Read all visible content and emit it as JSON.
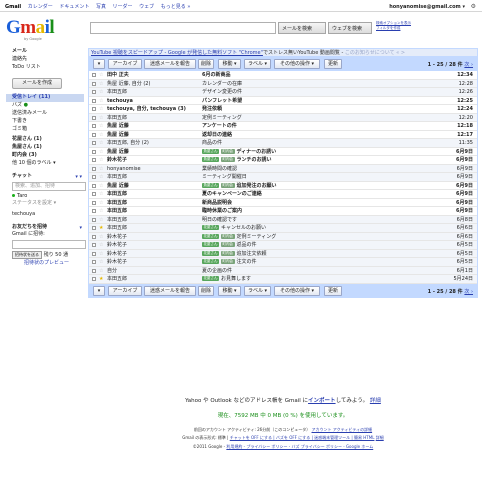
{
  "topnav": [
    "Gmail",
    "カレンダー",
    "ドキュメント",
    "写真",
    "リーダー",
    "ウェブ",
    "もっと見る »"
  ],
  "account_email": "honyanomise@gmail.com ▾",
  "logo": {
    "text": "Gmail",
    "sub": "by Google"
  },
  "search": {
    "mail_button": "メールを検索",
    "web_button": "ウェブを検索",
    "options_link_1": "検索オプションを表示",
    "options_link_2": "フィルタを作成"
  },
  "sidebar": {
    "top_items": [
      "メール",
      "連絡先",
      "ToDo リスト"
    ],
    "compose": "メールを作成",
    "items": [
      "受信トレイ (11)",
      "バズ",
      "送信済みメール",
      "下書き",
      "ゴミ箱"
    ],
    "labels": [
      "花屋さん (1)",
      "魚屋さん (1)",
      "町内会 (3)",
      "他 10 個のラベル ▾"
    ],
    "chat_title": "チャット",
    "chat_search": "検索、追加、招待",
    "chat_user": "Taro",
    "chat_status": "ステータスを設定 ▾",
    "chat_contact": "techouya",
    "invite_title": "お友だちを招待",
    "invite_text": "Gmail に招待:",
    "invite_button": "招待状を送る",
    "invite_remaining": "残り 50 通",
    "invite_preview": "招待状のプレビュー"
  },
  "promo": {
    "link": "YouTube 視聴をスピードアップ - Google が発信した無料ソフト \"Chrome\"",
    "text": "でストレス無いYouTube 動画閲覧 - ",
    "tail": "このお知らせについて « >"
  },
  "toolbar": {
    "archive": "アーカイブ",
    "spam": "迷惑メールを報告",
    "delete": "削除",
    "move": "移動 ▾",
    "label": "ラベル ▾",
    "more": "その他の操作 ▾",
    "refresh": "更新",
    "count": "1 - 25 / 28 件",
    "next": "次 ›"
  },
  "emails": [
    {
      "sender": "田中 正夫",
      "subject": "6月の新商品",
      "labels": [],
      "time": "12:34",
      "unread": true,
      "star": false
    },
    {
      "sender": "魚屋 近藤, 自分 (2)",
      "subject": "カレンダーの在庫",
      "labels": [],
      "time": "12:28",
      "unread": false,
      "star": false
    },
    {
      "sender": "本田五郎",
      "subject": "デザイン変更の件",
      "labels": [],
      "time": "12:26",
      "unread": false,
      "star": false
    },
    {
      "sender": "techouya",
      "subject": "パンフレット希望",
      "labels": [],
      "time": "12:25",
      "unread": true,
      "star": false
    },
    {
      "sender": "techouya, 自分, techouya (3)",
      "subject": "発注依頼",
      "labels": [],
      "time": "12:24",
      "unread": true,
      "star": false
    },
    {
      "sender": "本田五郎",
      "subject": "定例ミーティング",
      "labels": [],
      "time": "12:20",
      "unread": false,
      "star": false
    },
    {
      "sender": "魚屋 近藤",
      "subject": "アンケートの件",
      "labels": [],
      "time": "12:18",
      "unread": true,
      "star": false
    },
    {
      "sender": "魚屋 近藤",
      "subject": "返却日の連絡",
      "labels": [],
      "time": "12:17",
      "unread": true,
      "star": false
    },
    {
      "sender": "本田五郎, 自分 (2)",
      "subject": "商品の件",
      "labels": [],
      "time": "11:35",
      "unread": false,
      "star": false
    },
    {
      "sender": "魚屋 近藤",
      "subject": "ディナーのお誘い",
      "labels": [
        "魚屋さん",
        "町内会"
      ],
      "time": "6月9日",
      "unread": true,
      "star": false
    },
    {
      "sender": "鈴木花子",
      "subject": "ランチのお誘い",
      "labels": [
        "魚屋さん",
        "町内会"
      ],
      "time": "6月9日",
      "unread": true,
      "star": false
    },
    {
      "sender": "honyanomise",
      "subject": "業績時間の確認",
      "labels": [],
      "time": "6月9日",
      "unread": false,
      "star": false
    },
    {
      "sender": "本田五郎",
      "subject": "ミーティング開催日",
      "labels": [],
      "time": "6月9日",
      "unread": false,
      "star": false
    },
    {
      "sender": "魚屋 近藤",
      "subject": "追加発注のお願い",
      "labels": [
        "魚屋さん",
        "町内会"
      ],
      "time": "6月9日",
      "unread": true,
      "star": false
    },
    {
      "sender": "本田五郎",
      "subject": "夏のキャンペーンのご連絡",
      "labels": [],
      "time": "6月9日",
      "unread": true,
      "star": false
    },
    {
      "sender": "本田五郎",
      "subject": "新商品説明会",
      "labels": [],
      "time": "6月9日",
      "unread": true,
      "star": false
    },
    {
      "sender": "本田五郎",
      "subject": "臨時休業のご案内",
      "labels": [],
      "time": "6月9日",
      "unread": true,
      "star": false
    },
    {
      "sender": "本田五郎",
      "subject": "明日の確認です",
      "labels": [],
      "time": "6月8日",
      "unread": false,
      "star": false
    },
    {
      "sender": "本田五郎",
      "subject": "キャンセルのお願い",
      "labels": [
        "花屋さん"
      ],
      "time": "6月6日",
      "unread": false,
      "star": true
    },
    {
      "sender": "鈴木花子",
      "subject": "定例ミーティング",
      "labels": [
        "花屋さん",
        "町内会"
      ],
      "time": "6月6日",
      "unread": false,
      "star": false
    },
    {
      "sender": "鈴木花子",
      "subject": "返品の件",
      "labels": [
        "花屋さん",
        "町内会"
      ],
      "time": "6月5日",
      "unread": false,
      "star": false
    },
    {
      "sender": "鈴木花子",
      "subject": "追加注文依頼",
      "labels": [
        "花屋さん",
        "町内会"
      ],
      "time": "6月5日",
      "unread": false,
      "star": false
    },
    {
      "sender": "鈴木花子",
      "subject": "注文の件",
      "labels": [
        "花屋さん",
        "町内会"
      ],
      "time": "6月5日",
      "unread": false,
      "star": false
    },
    {
      "sender": "自分",
      "subject": "夏の企画の件",
      "labels": [],
      "time": "6月1日",
      "unread": false,
      "star": false
    },
    {
      "sender": "本田五郎",
      "subject": "お見舞します",
      "labels": [
        "花屋さん"
      ],
      "time": "5月24日",
      "unread": false,
      "star": true
    }
  ],
  "footer": {
    "import_prefix": "Yahoo や Outlook などのアドレス帳を Gmail に",
    "import_link": "インポート",
    "import_suffix": "してみよう。",
    "import_detail": "詳細",
    "usage": "現在、7592 MB 中 0 MB (0 %) を使用しています。",
    "activity": "前回のアカウント アクティビティ: 26分前（このコンピュータ）",
    "activity_link": "アカウント アクティビティの詳細",
    "view": "Gmail の表示形式: 標準 |",
    "view_links": "チャットを OFF にする | バズを OFF にする | 迷惑端末管理ツール | 簡易 HTML",
    "view_detail": "詳細",
    "copyright": "©2011 Google -",
    "copyright_links": "利用規約 - プライバシー ポリシー - バズ プライバシー ポリシー - Google ホーム"
  }
}
